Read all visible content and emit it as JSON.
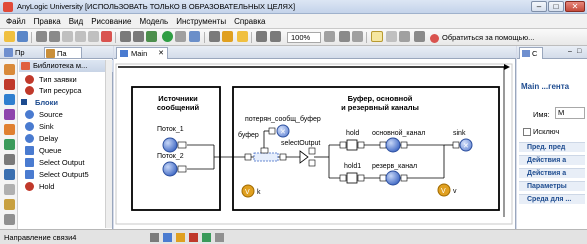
{
  "window": {
    "title": "AnyLogic University [ИСПОЛЬЗОВАТЬ ТОЛЬКО В ОБРАЗОВАТЕЛЬНЫХ ЦЕЛЯХ]",
    "minimize": "–",
    "maximize": "□",
    "close": "✕"
  },
  "menu": [
    "Файл",
    "Правка",
    "Вид",
    "Рисование",
    "Модель",
    "Инструменты",
    "Справка"
  ],
  "toolbar": {
    "zoom": "100%",
    "feedback": "Обратиться за помощью..."
  },
  "left_panel": {
    "tabs": [
      "Пр",
      "Па"
    ],
    "library_title": "Библиотека м...",
    "items": [
      {
        "label": "Тип заявки",
        "color": "#c0392b"
      },
      {
        "label": "Тип ресурса",
        "color": "#c0392b"
      },
      {
        "label": "Блоки",
        "color": "#1d4b8f"
      },
      {
        "label": "Source",
        "color": "#4a7bd0"
      },
      {
        "label": "Sink",
        "color": "#4a7bd0"
      },
      {
        "label": "Delay",
        "color": "#4a7bd0"
      },
      {
        "label": "Queue",
        "color": "#4a7bd0"
      },
      {
        "label": "Select Output",
        "color": "#4a7bd0"
      },
      {
        "label": "Select Output5",
        "color": "#4a7bd0"
      },
      {
        "label": "Hold",
        "color": "#c0392b"
      }
    ]
  },
  "editor": {
    "tab": "Main",
    "diagram": {
      "box1_title": [
        "Источники",
        "сообщений"
      ],
      "box2_title": [
        "Буфер, основной",
        "и резервный каналы"
      ],
      "nodes": {
        "source1": "Поток_1",
        "source2": "Поток_2",
        "buffer": "буфер",
        "lost": "потерян_сообщ_буфер",
        "select": "selectOutput",
        "hold": "hold",
        "hold1": "hold1",
        "main_channel": "основной_канал",
        "reserve_channel": "резерв_канал",
        "sink": "sink",
        "var_k": "k",
        "var_v": "v",
        "badge": "V"
      }
    }
  },
  "right_panel": {
    "tab": "С",
    "title": "Main ...гента",
    "name_label": "Имя:",
    "name_value": "M",
    "exclude_label": "Исключ",
    "sections": [
      "Пред. пред",
      "Действия а",
      "Действия а",
      "Параметры",
      "Среда для ..."
    ]
  },
  "status": {
    "text": "Направление связи4"
  }
}
